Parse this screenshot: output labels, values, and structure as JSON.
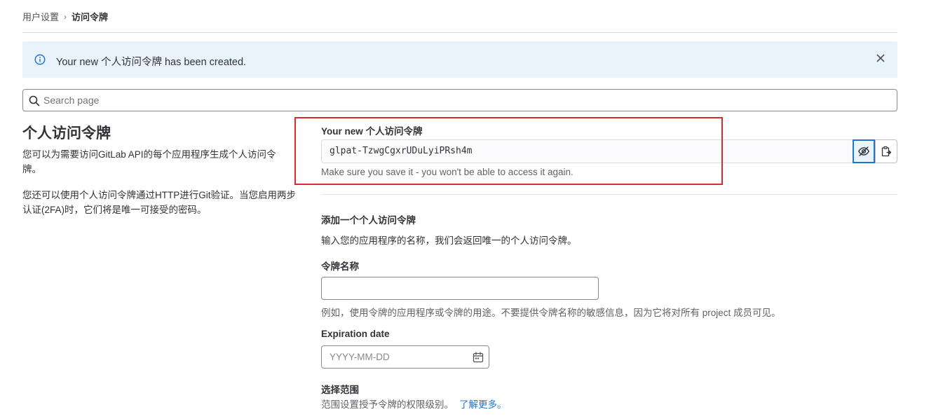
{
  "breadcrumb": {
    "parent": "用户设置",
    "separator": "›",
    "current": "访问令牌"
  },
  "alert": {
    "text": "Your new 个人访问令牌 has been created.",
    "icon": "info-icon",
    "close_icon": "close-icon"
  },
  "search": {
    "placeholder": "Search page",
    "value": ""
  },
  "left": {
    "title": "个人访问令牌",
    "desc1": "您可以为需要访问GitLab API的每个应用程序生成个人访问令牌。",
    "desc2": "您还可以使用个人访问令牌通过HTTP进行Git验证。当您启用两步认证(2FA)时，它们将是唯一可接受的密码。"
  },
  "new_token": {
    "label": "Your new 个人访问令牌",
    "value": "glpat-TzwgCgxrUDuLyiPRsh4m",
    "help": "Make sure you save it - you won't be able to access it again.",
    "reveal_icon": "eye-slash-icon",
    "copy_icon": "clipboard-icon"
  },
  "add_token": {
    "title": "添加一个个人访问令牌",
    "desc": "输入您的应用程序的名称，我们会返回唯一的个人访问令牌。",
    "name_label": "令牌名称",
    "name_value": "",
    "name_help": "例如，使用令牌的应用程序或令牌的用途。不要提供令牌名称的敏感信息，因为它将对所有 project 成员可见。",
    "expiration_label": "Expiration date",
    "expiration_placeholder": "YYYY-MM-DD",
    "scope_label": "选择范围",
    "scope_desc": "范围设置授予令牌的权限级别。",
    "scope_link": "了解更多。"
  },
  "colors": {
    "accent": "#1f75cb",
    "alert_bg": "#e9f3fc",
    "highlight": "#dd2b2b"
  }
}
